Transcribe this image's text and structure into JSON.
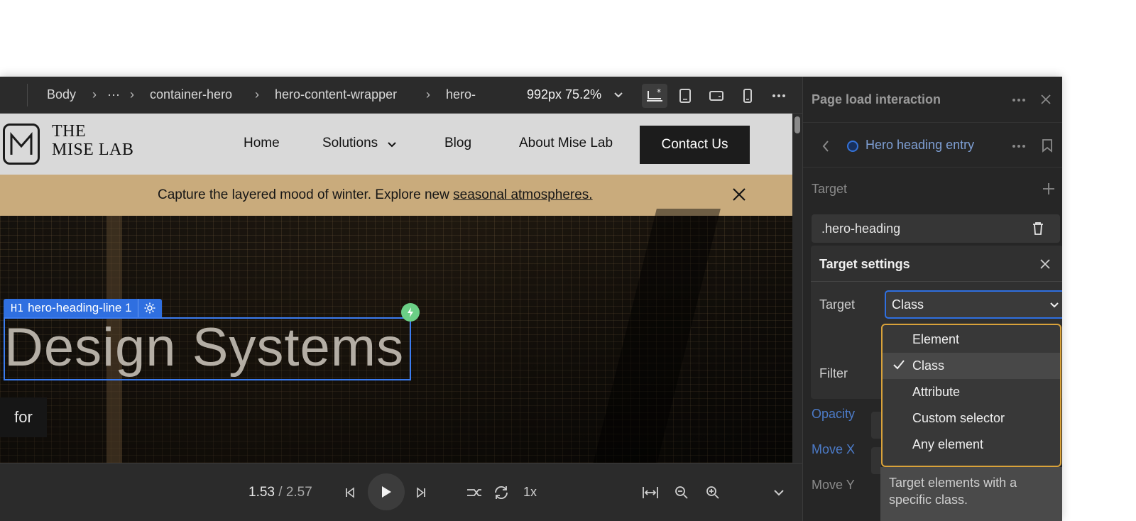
{
  "toolbar": {
    "breadcrumbs": [
      "Body",
      "···",
      "container-hero",
      "hero-content-wrapper",
      "hero-"
    ],
    "zoom": "992px 75.2%"
  },
  "site": {
    "logo_line1": "THE",
    "logo_line2": "MISE LAB",
    "nav": [
      "Home",
      "Solutions",
      "Blog",
      "About Mise Lab"
    ],
    "cta": "Contact Us",
    "banner_text": "Capture the layered mood of winter. Explore new ",
    "banner_link": "seasonal atmospheres.",
    "selection_tag": "H1",
    "selection_name": "hero-heading-line 1",
    "heading": "Design Systems",
    "for_text": "for"
  },
  "playback": {
    "current": "1.53",
    "separator": " / ",
    "total": "2.57",
    "speed": "1x"
  },
  "panel": {
    "title": "Page load interaction",
    "entry": "Hero heading entry",
    "target_label": "Target",
    "target_value": ".hero-heading",
    "settings_title": "Target settings",
    "settings_target_label": "Target",
    "settings_target_value": "Class",
    "filter_label": "Filter",
    "props": [
      "Opacity",
      "Move X",
      "Move Y"
    ],
    "dropdown": {
      "options": [
        "Element",
        "Class",
        "Attribute",
        "Custom selector",
        "Any element"
      ],
      "selected": "Class"
    },
    "tooltip": "Target elements with a specific class."
  },
  "colors": {
    "accent": "#2f6fe0",
    "dropdown_border": "#d9a23a",
    "banner": "#c9ab7c",
    "bolt": "#6bcf86"
  }
}
